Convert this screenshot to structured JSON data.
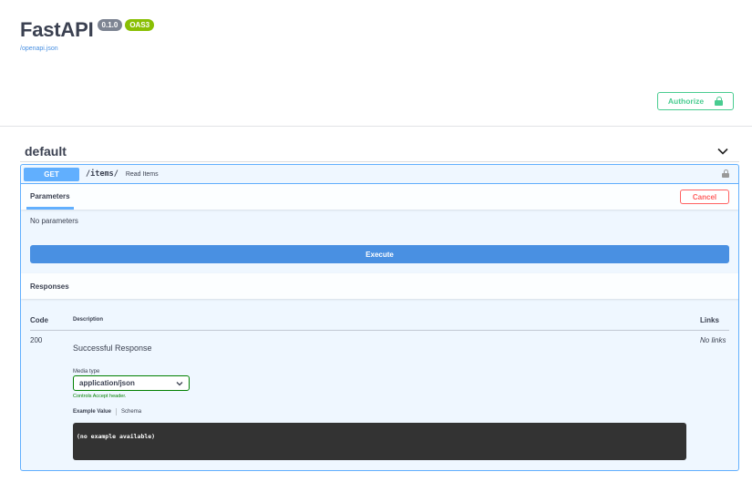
{
  "info": {
    "title": "FastAPI",
    "version_badge": "0.1.0",
    "oas_badge": "OAS3",
    "openapi_link": "/openapi.json"
  },
  "authorize": {
    "label": "Authorize",
    "icon": "lock-icon"
  },
  "tag": {
    "name": "default",
    "toggle_icon": "chevron-down-icon"
  },
  "operation": {
    "method": "GET",
    "path": "/items/",
    "summary": "Read Items",
    "parameters_tab": "Parameters",
    "cancel_label": "Cancel",
    "no_parameters": "No parameters",
    "execute_label": "Execute",
    "responses_title": "Responses",
    "table_headers": {
      "code": "Code",
      "description": "Description",
      "links": "Links"
    },
    "responses": [
      {
        "code": "200",
        "description": "Successful Response",
        "links": "No links",
        "media_type_label": "Media type",
        "media_type_value": "application/json",
        "controls_accept": "Controls Accept header.",
        "example_tab": "Example Value",
        "schema_tab": "Schema",
        "example": "(no example available)"
      }
    ]
  },
  "colors": {
    "get": "#61affe",
    "authorize": "#49cc90",
    "cancel": "#ff6060",
    "execute": "#4990e2"
  }
}
